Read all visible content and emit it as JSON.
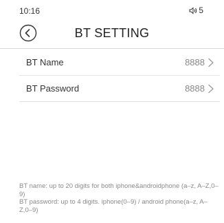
{
  "status_bar": {
    "time": "10:16",
    "volume_icon": "speaker-volume-icon",
    "volume_level": "5"
  },
  "header": {
    "title": "BT SETTING",
    "back_icon": "back-circle-icon"
  },
  "settings": [
    {
      "label": "BT Name",
      "value": "8888"
    },
    {
      "label": "BT Password",
      "value": "8888"
    }
  ],
  "footer": {
    "line1": "BT name: up to 20 digits for both iphone&androidphone (a–z, A–Z,0–9)",
    "line2": "BT password: up to 4 digits. iphone(0–9) / android phone(a–z, A–Z,0–9)"
  },
  "colors": {
    "background": "#ffffff",
    "text_primary": "#333333",
    "text_secondary": "#888888",
    "divider": "#d8d8d8"
  }
}
